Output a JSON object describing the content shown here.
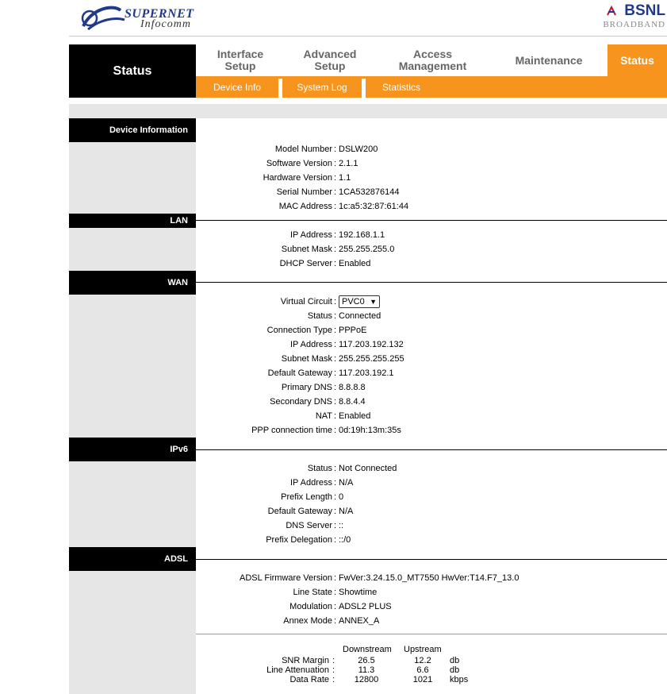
{
  "header": {
    "logo_left_top": "SUPERNET",
    "logo_left_bottom": "Infocomm",
    "logo_right_top": "BSNL",
    "logo_right_bottom": "BROADBAND"
  },
  "nav": {
    "current_section": "Status",
    "tabs": [
      {
        "label_line1": "Interface",
        "label_line2": "Setup"
      },
      {
        "label_line1": "Advanced",
        "label_line2": "Setup"
      },
      {
        "label_line1": "Access",
        "label_line2": "Management"
      },
      {
        "label_line1": "Maintenance",
        "label_line2": ""
      },
      {
        "label_line1": "Status",
        "label_line2": ""
      }
    ],
    "subtabs": [
      "Device Info",
      "System Log",
      "Statistics"
    ]
  },
  "device_info": {
    "title": "Device Information",
    "rows": [
      {
        "label": "Model Number",
        "value": "DSLW200"
      },
      {
        "label": "Software Version",
        "value": "2.1.1"
      },
      {
        "label": "Hardware Version",
        "value": "1.1"
      },
      {
        "label": "Serial Number",
        "value": "1CA532876144"
      },
      {
        "label": "MAC Address",
        "value": "1c:a5:32:87:61:44"
      }
    ]
  },
  "lan": {
    "title": "LAN",
    "rows": [
      {
        "label": "IP Address",
        "value": "192.168.1.1"
      },
      {
        "label": "Subnet Mask",
        "value": "255.255.255.0"
      },
      {
        "label": "DHCP Server",
        "value": "Enabled"
      }
    ]
  },
  "wan": {
    "title": "WAN",
    "virtual_circuit_label": "Virtual Circuit",
    "virtual_circuit_value": "PVC0",
    "rows": [
      {
        "label": "Status",
        "value": "Connected"
      },
      {
        "label": "Connection Type",
        "value": "PPPoE"
      },
      {
        "label": "IP Address",
        "value": "117.203.192.132"
      },
      {
        "label": "Subnet Mask",
        "value": "255.255.255.255"
      },
      {
        "label": "Default Gateway",
        "value": "117.203.192.1"
      },
      {
        "label": "Primary DNS",
        "value": "8.8.8.8"
      },
      {
        "label": "Secondary DNS",
        "value": "8.8.4.4"
      },
      {
        "label": "NAT",
        "value": "Enabled"
      },
      {
        "label": "PPP connection time",
        "value": "0d:19h:13m:35s"
      }
    ]
  },
  "ipv6": {
    "title": "IPv6",
    "rows": [
      {
        "label": "Status",
        "value": "Not Connected"
      },
      {
        "label": "IP Address",
        "value": "N/A"
      },
      {
        "label": "Prefix Length",
        "value": "0"
      },
      {
        "label": "Default Gateway",
        "value": "N/A"
      },
      {
        "label": "DNS Server",
        "value": "::"
      },
      {
        "label": "Prefix Delegation",
        "value": "::/0"
      }
    ]
  },
  "adsl": {
    "title": "ADSL",
    "rows": [
      {
        "label": "ADSL Firmware Version",
        "value": "FwVer:3.24.15.0_MT7550 HwVer:T14.F7_13.0"
      },
      {
        "label": "Line State",
        "value": "Showtime"
      },
      {
        "label": "Modulation",
        "value": "ADSL2 PLUS"
      },
      {
        "label": "Annex Mode",
        "value": "ANNEX_A"
      }
    ],
    "stats_headers": {
      "downstream": "Downstream",
      "upstream": "Upstream"
    },
    "stats": [
      {
        "label": "SNR Margin",
        "down": "26.5",
        "up": "12.2",
        "unit": "db"
      },
      {
        "label": "Line Attenuation",
        "down": "11.3",
        "up": "6.6",
        "unit": "db"
      },
      {
        "label": "Data Rate",
        "down": "12800",
        "up": "1021",
        "unit": "kbps"
      }
    ]
  }
}
